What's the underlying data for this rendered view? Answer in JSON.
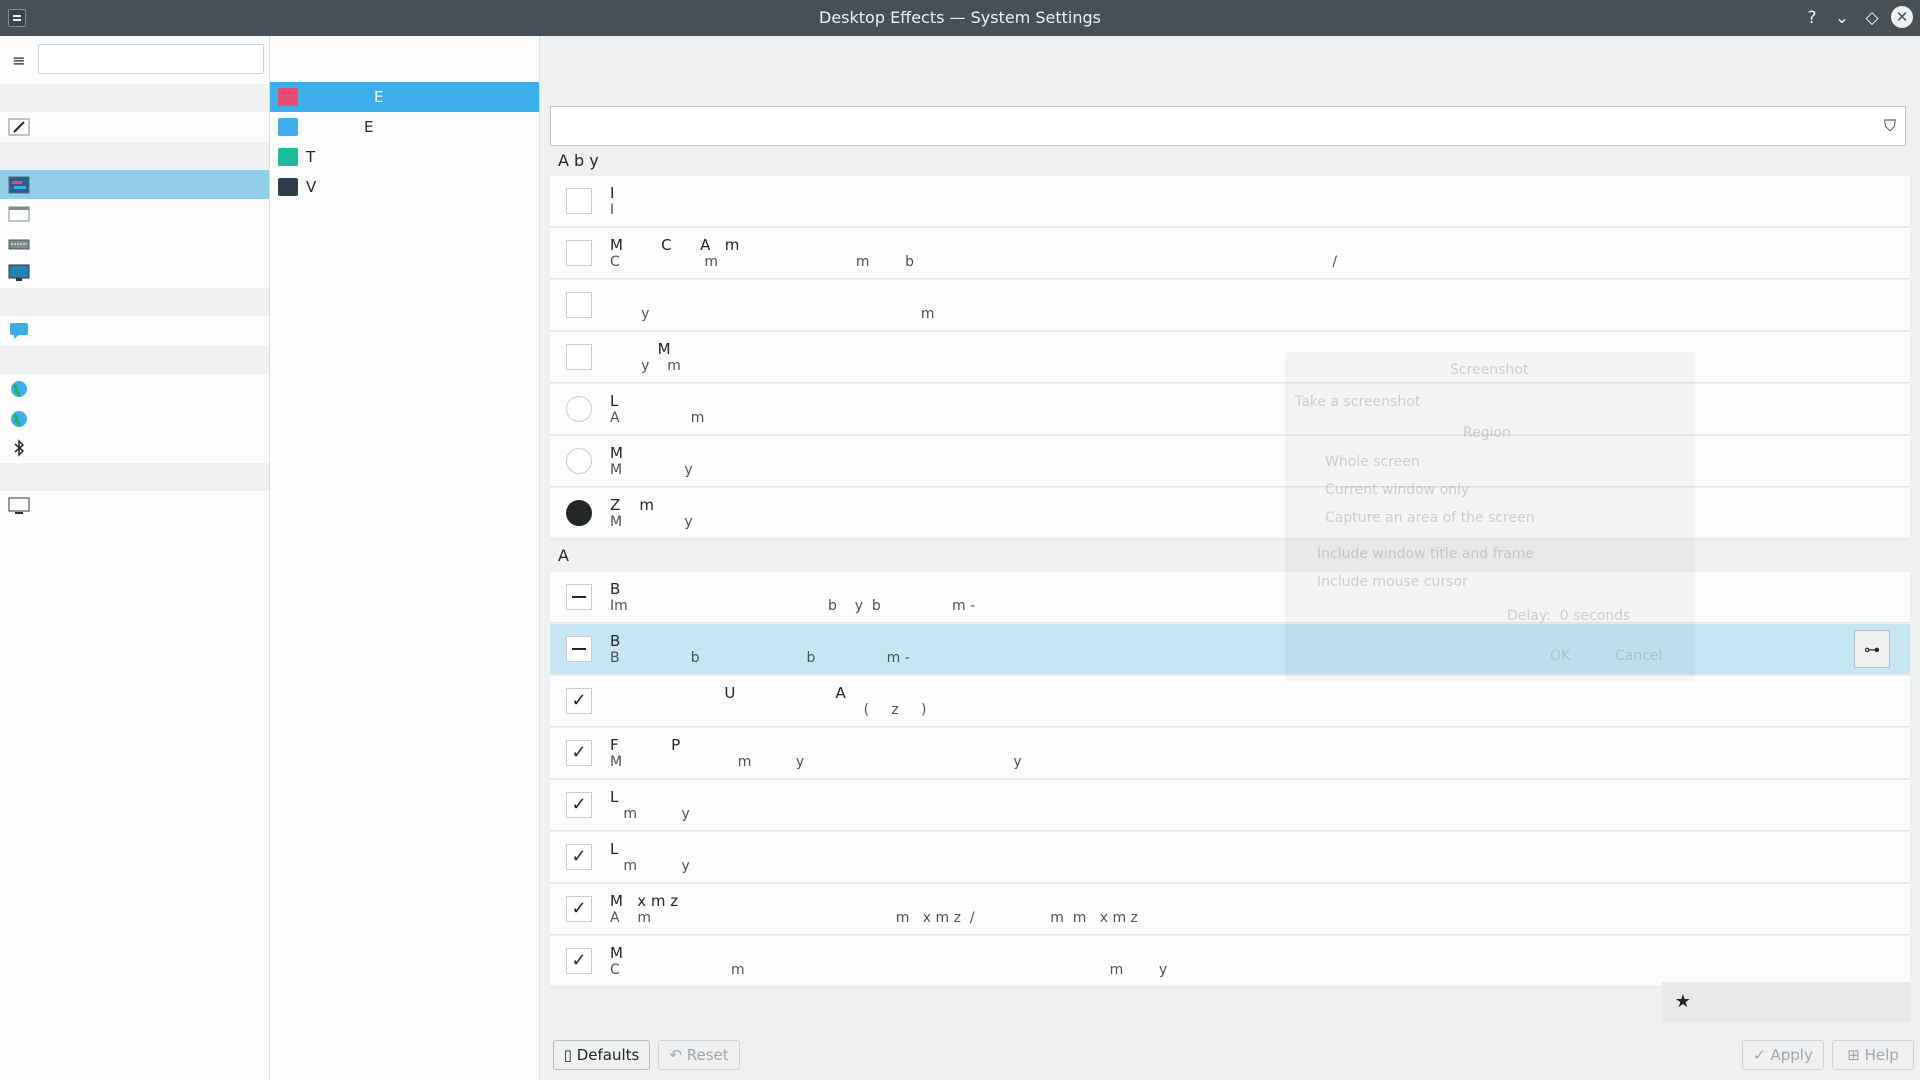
{
  "window": {
    "title": "Desktop Effects — System Settings",
    "help_glyph": "?",
    "min_glyph": "⌄",
    "max_glyph": "◇",
    "close_glyph": "✕"
  },
  "sidebar": {
    "hamburger_glyph": "≡",
    "search_value": ""
  },
  "subcategories": [
    {
      "label": "E",
      "color": "#3daee9"
    },
    {
      "label": "E",
      "color": "#e94b6c"
    },
    {
      "label": "T",
      "color": "#1abc9c"
    },
    {
      "label": "V",
      "color": "#2c3e50"
    }
  ],
  "filter": {
    "value": "",
    "icon": "filter-icon",
    "glyph": "⛉"
  },
  "groups": {
    "accessibility": "A        b   y",
    "appearance": "A"
  },
  "effects": [
    {
      "title": "I",
      "desc": "I",
      "control": "checkbox",
      "state": ""
    },
    {
      "title": "M        C      A   m",
      "desc": "C                   m                               m        b                                                                                              /",
      "control": "checkbox",
      "state": ""
    },
    {
      "title": "",
      "desc": "       y                                                             m",
      "control": "checkbox",
      "state": ""
    },
    {
      "title": "          M",
      "desc": "       y    m",
      "control": "checkbox",
      "state": ""
    },
    {
      "title": "L",
      "desc": "A                m",
      "control": "radio",
      "state": ""
    },
    {
      "title": "M",
      "desc": "M              y",
      "control": "radio",
      "state": ""
    },
    {
      "title": "Z    m",
      "desc": "M              y",
      "control": "radio-on",
      "state": ""
    },
    {
      "title": "B",
      "desc": "Im                                             b    y  b                m -",
      "control": "mixed",
      "state": ""
    },
    {
      "title": "B",
      "desc": "B                b                        b                m -",
      "control": "mixed",
      "state": ""
    },
    {
      "title": "                        U                     A",
      "desc": "                                                         (     z     )",
      "control": "checked",
      "state": "✓"
    },
    {
      "title": "F           P",
      "desc": "M                          m          y                                               y",
      "control": "checked",
      "state": "✓"
    },
    {
      "title": "L",
      "desc": "   m          y",
      "control": "checked",
      "state": "✓"
    },
    {
      "title": "L",
      "desc": "   m          y",
      "control": "checked",
      "state": "✓"
    },
    {
      "title": "M   x m z",
      "desc": "A    m                                                       m   x m z  /                 m  m   x m z",
      "control": "checked",
      "state": "✓"
    },
    {
      "title": "M",
      "desc": "C                         m                                                                                  m        y",
      "control": "checked",
      "state": "✓"
    }
  ],
  "config_glyph": "⊶",
  "star_glyph": "★",
  "buttons": {
    "defaults": "Defaults",
    "reset": "Reset",
    "apply": "Apply",
    "help": "Help",
    "defaults_glyph": "▯",
    "reset_glyph": "↶",
    "apply_glyph": "✓",
    "help_glyph": "⊞"
  },
  "ghost_dialog": {
    "title": "Screenshot",
    "take": "Take a screenshot",
    "region": "Region",
    "whole": "Whole screen",
    "current": "Current window only",
    "area": "Capture an area of the screen",
    "include_title": "Include window title and frame",
    "include_cursor": "Include mouse cursor",
    "delay": "Delay:  0 seconds",
    "ok": "OK",
    "cancel": "Cancel"
  }
}
